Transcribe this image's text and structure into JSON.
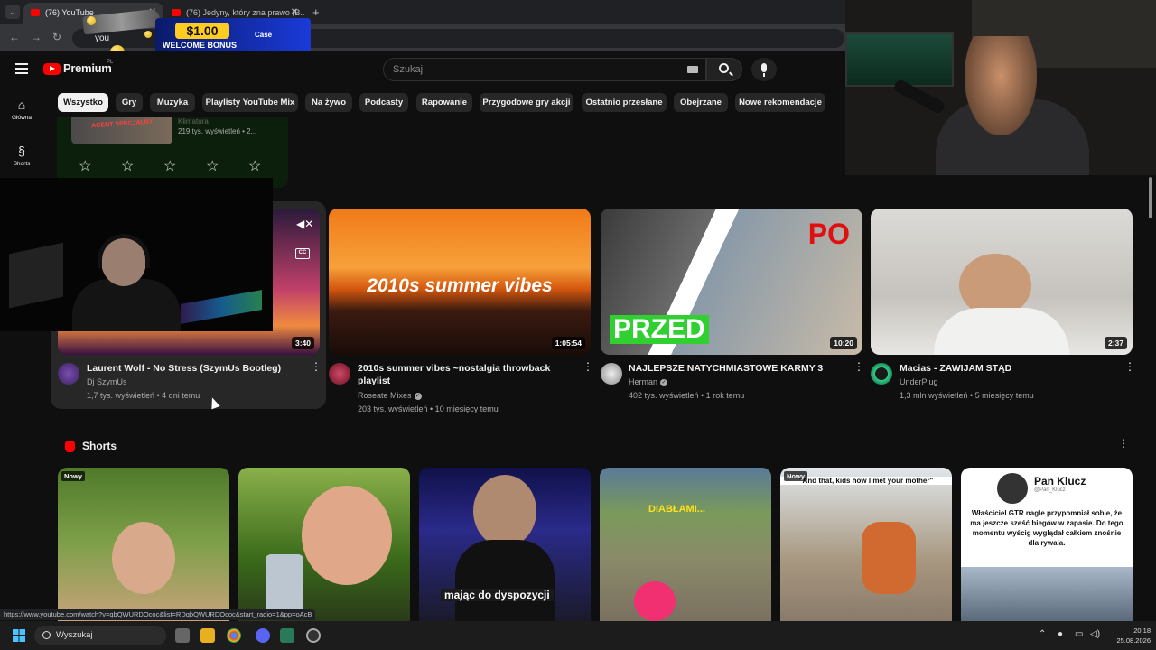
{
  "browser": {
    "tabs": [
      {
        "label": "(76) YouTube",
        "active": true
      },
      {
        "label": "(76) Jedyny, który zna prawo (B...",
        "active": false
      }
    ],
    "new_tab": "+",
    "omnibox": "you",
    "status_url": "https://www.youtube.com/watch?v=qbQWURDOcoc&list=RDqbQWURDOcoc&start_radio=1&pp=oAcB"
  },
  "ad": {
    "amount": "$1.00",
    "text": "WELCOME BONUS",
    "brand": "Case",
    "brand_accent": "#ffcc22"
  },
  "header": {
    "logo": "Premium",
    "country": "PL",
    "search_placeholder": "Szukaj"
  },
  "sidebar": {
    "items": [
      {
        "label": "Główna",
        "icon": "home-icon"
      },
      {
        "label": "Shorts",
        "icon": "shorts-icon"
      }
    ]
  },
  "chips": [
    "Wszystko",
    "Gry",
    "Muzyka",
    "Playlisty YouTube Mix",
    "Na żywo",
    "Podcasty",
    "Rapowanie",
    "Przygodowe gry akcji",
    "Ostatnio przesłane",
    "Obejrzane",
    "Nowe rekomendacje"
  ],
  "rating_card": {
    "thumb_text": "AGENT SPECJALNY",
    "title": "Klimatura",
    "meta": "219 tys. wyświetleń • 2..."
  },
  "videos": [
    {
      "title": "Laurent Wolf - No Stress (SzymUs Bootleg)",
      "channel": "Dj SzymUs",
      "verified": false,
      "stats": "1,7 tys. wyświetleń • 4 dni temu",
      "duration": "3:40"
    },
    {
      "title": "2010s summer vibes ~nostalgia throwback playlist",
      "channel": "Roseate Mixes",
      "verified": true,
      "stats": "203 tys. wyświetleń • 10 miesięcy temu",
      "duration": "1:05:54",
      "thumb_text": "2010s summer vibes"
    },
    {
      "title": "NAJLEPSZE NATYCHMIASTOWE KARMY 3",
      "channel": "Herman",
      "verified": true,
      "stats": "402 tys. wyświetleń • 1 rok temu",
      "duration": "10:20",
      "thumb_text_top": "PO",
      "thumb_text_bottom": "PRZED"
    },
    {
      "title": "Macias - ZAWIJAM STĄD",
      "channel": "UnderPlug",
      "verified": false,
      "stats": "1,3 mln wyświetleń • 5 miesięcy temu",
      "duration": "2:37"
    }
  ],
  "shorts": {
    "title": "Shorts",
    "items": [
      {
        "badge": "Nowy",
        "caption": ""
      },
      {
        "badge": "",
        "caption": ""
      },
      {
        "badge": "",
        "caption": "mając do dyspozycji"
      },
      {
        "badge": "",
        "caption": "DIABŁAMI..."
      },
      {
        "badge": "Nowy",
        "caption": "\"And that, kids how I met your mother\""
      },
      {
        "badge": "",
        "caption": "Właściciel GTR nagle przypomniał sobie, że ma jeszcze sześć biegów w zapasie. Do tego momentu wyścig wyglądał całkiem znośnie dla rywala.",
        "author": "Pan Klucz",
        "handle": "@Pan_Klucz"
      }
    ]
  },
  "taskbar": {
    "search": "Wyszukaj",
    "time": "20:18",
    "date": "25.08.2026"
  }
}
